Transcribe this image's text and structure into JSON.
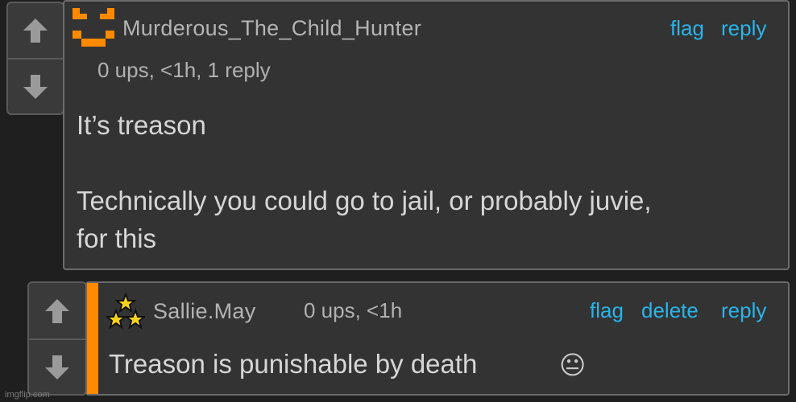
{
  "comment1": {
    "username": "Murderous_The_Child_Hunter",
    "meta": "0 ups, <1h, 1 reply",
    "actions": {
      "flag": "flag",
      "reply": "reply"
    },
    "body": [
      "It’s treason",
      "Technically you could go to jail, or probably juvie,",
      "for this"
    ],
    "avatar": "orange-face-icon"
  },
  "comment2": {
    "username": "Sallie.May",
    "meta": "0 ups, <1h",
    "actions": {
      "flag": "flag",
      "delete": "delete",
      "reply": "reply"
    },
    "body": "Treason is punishable by death",
    "emoji": "😐",
    "avatar": "three-stars-icon"
  },
  "watermark": "imgflip.com",
  "colors": {
    "link": "#2ab4ea",
    "op_bar": "#ff8a00",
    "avatar_orange": "#ff8a00"
  }
}
